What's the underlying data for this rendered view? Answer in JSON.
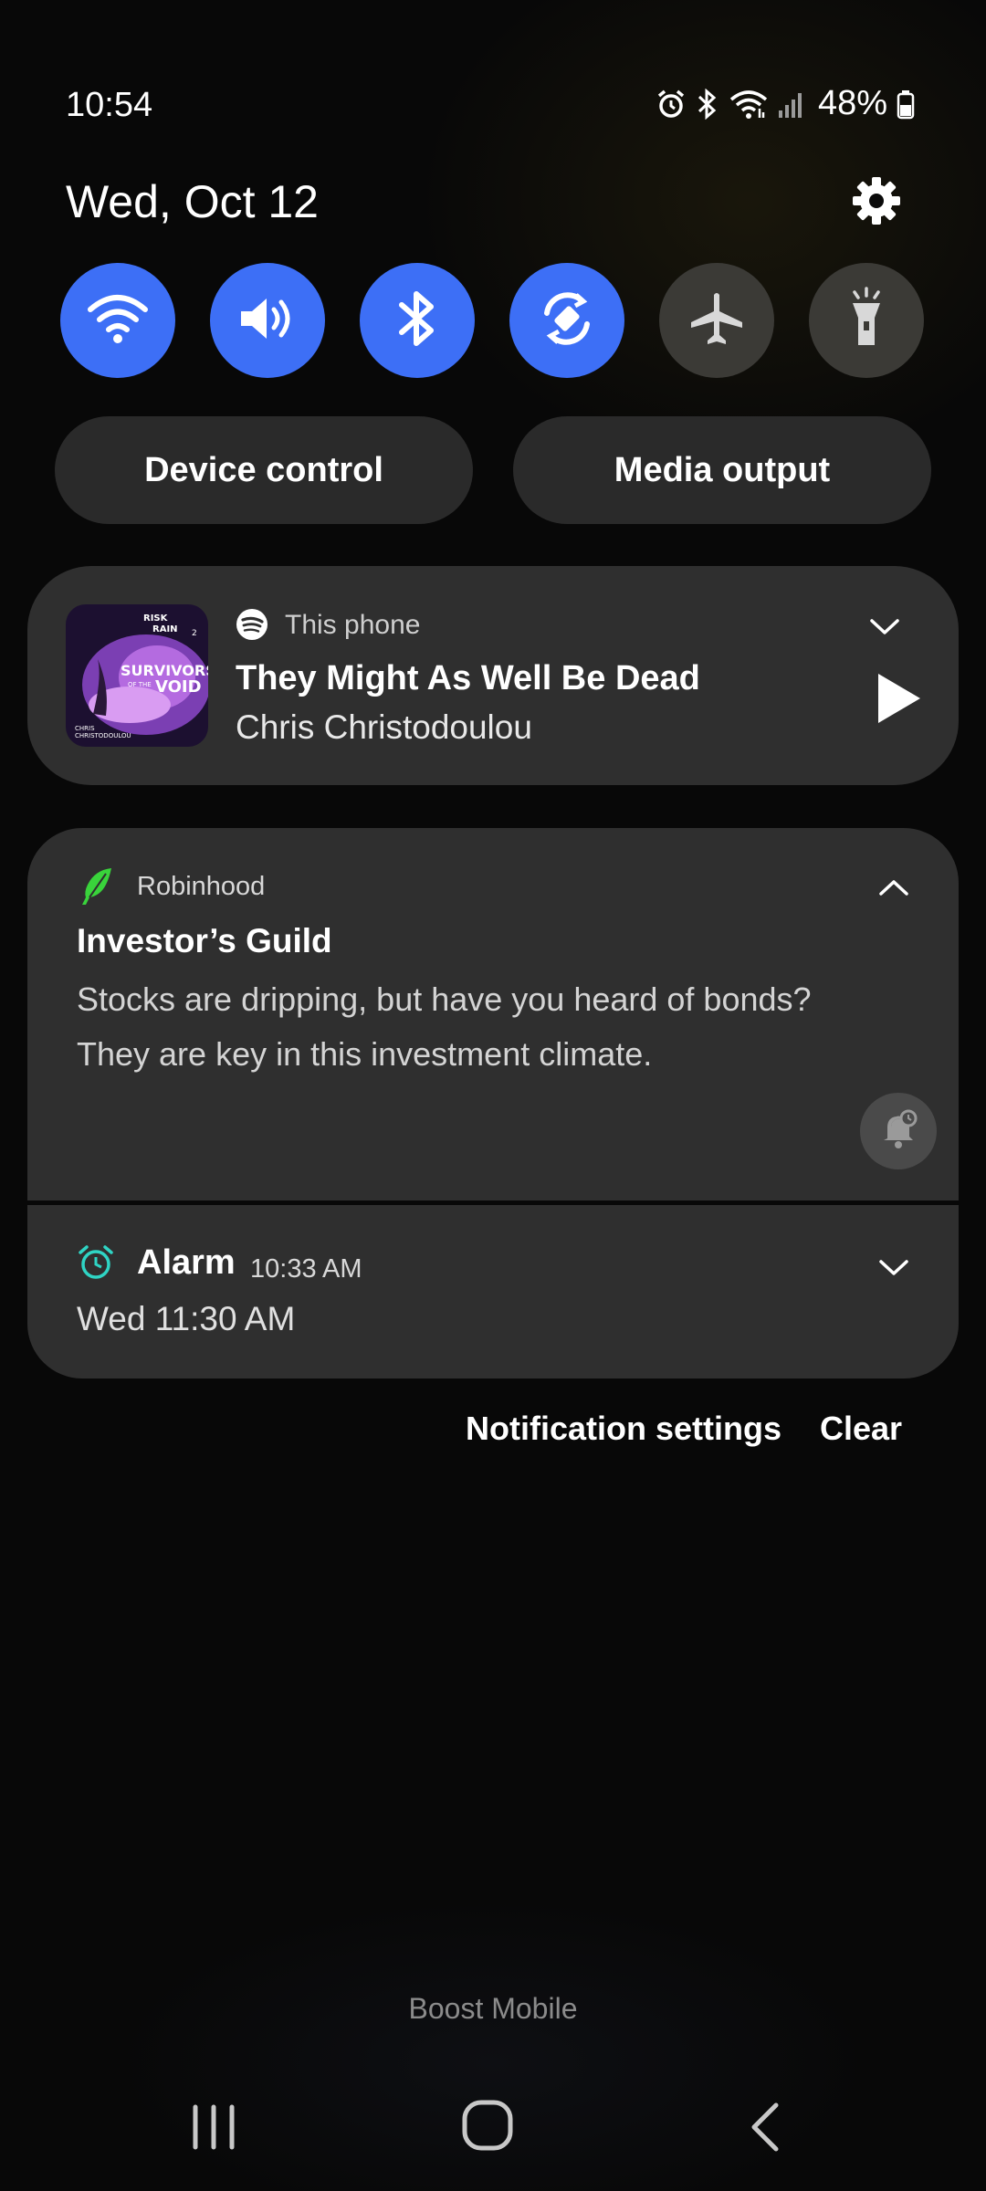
{
  "status_bar": {
    "time": "10:54",
    "battery": "48%",
    "icons": [
      "alarm-icon",
      "bluetooth-icon",
      "wifi-icon",
      "signal-icon",
      "battery-icon"
    ]
  },
  "header": {
    "date": "Wed, Oct 12",
    "settings_icon": "gear-icon"
  },
  "quick_toggles": [
    {
      "name": "wifi",
      "state": "on"
    },
    {
      "name": "sound",
      "state": "on"
    },
    {
      "name": "bluetooth",
      "state": "on"
    },
    {
      "name": "auto-rotate",
      "state": "on"
    },
    {
      "name": "airplane-mode",
      "state": "off"
    },
    {
      "name": "flashlight",
      "state": "off"
    }
  ],
  "pills": {
    "device_control": "Device control",
    "media_output": "Media output"
  },
  "media": {
    "source": "This phone",
    "title": "They Might As Well Be Dead",
    "artist": "Chris Christodoulou",
    "album_art_text": {
      "top_line1": "RISK",
      "top_line2": "RAIN",
      "top_num": "2",
      "title_line1": "SURVIVORS",
      "title_small": "OF THE",
      "title_line2": "VOID",
      "credit_line1": "CHRIS",
      "credit_line2": "CHRISTODOULOU"
    }
  },
  "notifications": {
    "robinhood": {
      "app": "Robinhood",
      "title": "Investor’s Guild",
      "body_line1": "Stocks are dripping, but have you heard of bonds?",
      "body_line2": "They are key in this investment climate."
    },
    "alarm": {
      "app": "Alarm",
      "time": "10:33 AM",
      "body": "Wed 11:30 AM"
    }
  },
  "actions": {
    "notification_settings": "Notification settings",
    "clear": "Clear"
  },
  "carrier": "Boost Mobile",
  "colors": {
    "accent_blue": "#3d6ff6",
    "toggle_off": "#3b3a36",
    "card_bg": "#2f2f2f",
    "robinhood_green": "#39d33b",
    "alarm_teal": "#2fd4c4"
  }
}
